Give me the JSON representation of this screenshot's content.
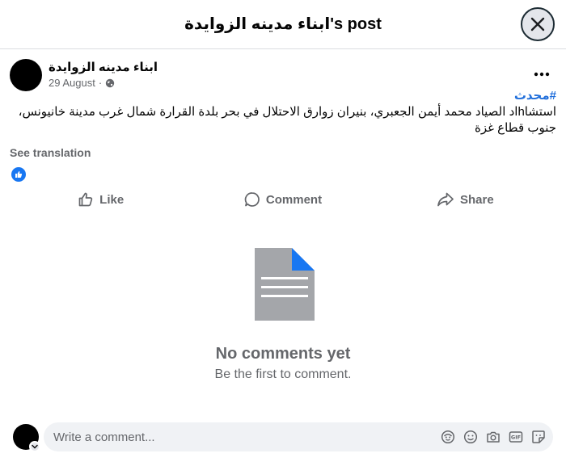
{
  "header": {
    "title": "ابناء مدينه الزوايدة's post"
  },
  "post": {
    "author": "ابناء مدينه الزوايدة",
    "date": "29 August",
    "dot": "·",
    "hashtag": "#محدث",
    "body": "استشاhاد الصياد محمد أيمن الجعبري، بنيران زوارق الاحتلال في بحر بلدة القرارة شمال غرب مدينة خانيونس، جنوب قطاع غزة",
    "see_translation": "See translation"
  },
  "actions": {
    "like": "Like",
    "comment": "Comment",
    "share": "Share"
  },
  "comments": {
    "empty_title": "No comments yet",
    "empty_subtitle": "Be the first to comment."
  },
  "composer": {
    "placeholder": "Write a comment...",
    "icons": [
      "avatar-sticker-icon",
      "emoji-icon",
      "camera-icon",
      "gif-icon",
      "sticker-icon"
    ]
  },
  "colors": {
    "link": "#216fdb",
    "like_blue": "#1877f2",
    "doc_gray": "#a4a6aa",
    "muted": "#65676b"
  }
}
